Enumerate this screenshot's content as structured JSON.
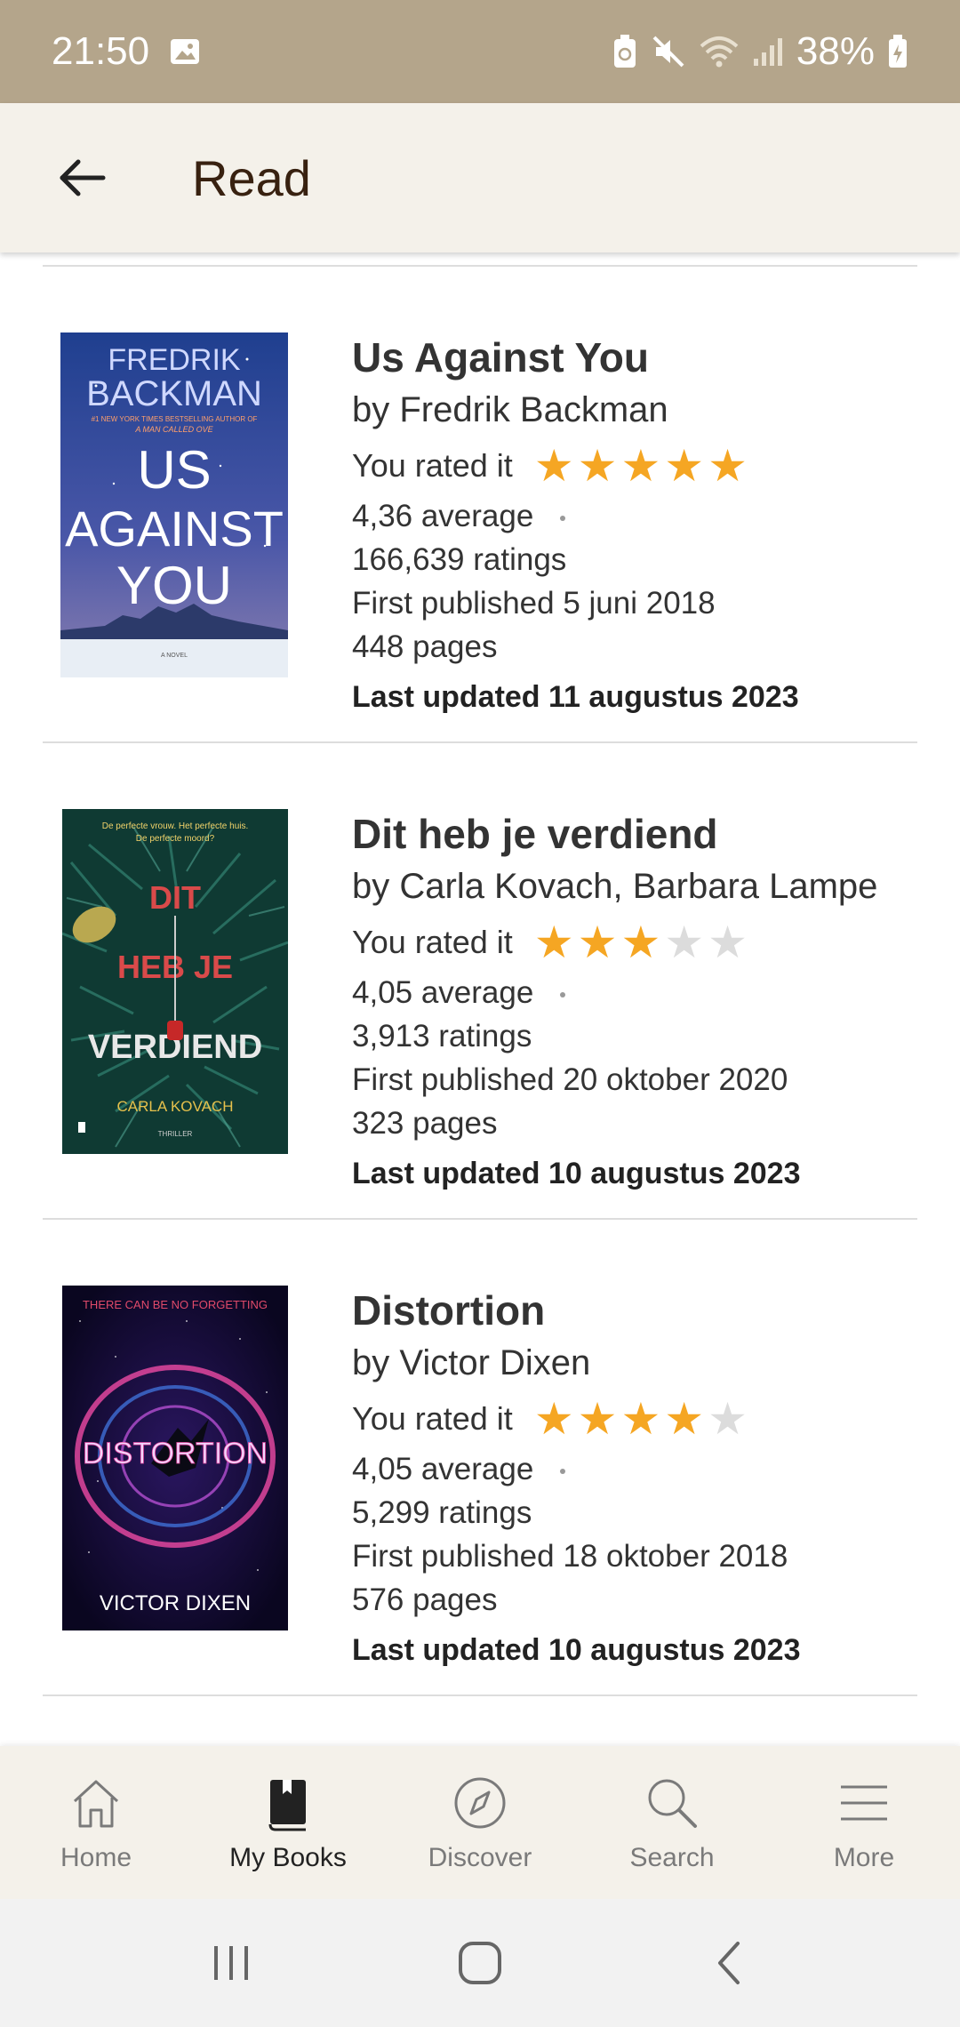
{
  "status_bar": {
    "time": "21:50",
    "battery": "38%"
  },
  "app_bar": {
    "title": "Read",
    "back_icon": "arrow-left-icon"
  },
  "books": [
    {
      "title": "Us Against You",
      "author": "by Fredrik Backman",
      "rated_label": "You rated it",
      "rating": 5,
      "average": "4,36 average",
      "ratings": "166,639 ratings",
      "published": "First published 5 juni 2018",
      "pages": "448 pages",
      "updated": "Last updated 11 augustus 2023",
      "cover": {
        "author_line1": "FREDRIK",
        "author_line2": "BACKMAN",
        "tagline_1": "#1 NEW YORK TIMES BESTSELLING AUTHOR OF",
        "tagline_2": "A MAN CALLED OVE",
        "title_1": "US",
        "title_2": "AGAINST",
        "title_3": "YOU",
        "footer": "A NOVEL",
        "bg_top": "#1f3f8f",
        "bg_bottom": "#6a5a9c"
      }
    },
    {
      "title": "Dit heb je verdiend",
      "author": "by Carla Kovach, Barbara Lampe",
      "rated_label": "You rated it",
      "rating": 3,
      "average": "4,05 average",
      "ratings": "3,913 ratings",
      "published": "First published 20 oktober 2020",
      "pages": "323 pages",
      "updated": "Last updated 10 augustus 2023",
      "cover": {
        "tagline_1": "De perfecte vrouw. Het perfecte huis.",
        "tagline_2": "De perfecte moord?",
        "title_1": "DIT",
        "title_2": "HEB JE",
        "title_3": "VERDIEND",
        "author": "CARLA KOVACH",
        "genre": "THRILLER",
        "bg": "#0f3a33"
      }
    },
    {
      "title": "Distortion",
      "author": "by Victor Dixen",
      "rated_label": "You rated it",
      "rating": 4,
      "average": "4,05 average",
      "ratings": "5,299 ratings",
      "published": "First published 18 oktober 2018",
      "pages": "576 pages",
      "updated": "Last updated 10 augustus 2023",
      "cover": {
        "tagline": "THERE CAN BE NO FORGETTING",
        "title": "DISTORTION",
        "author": "VICTOR DIXEN",
        "bg": "#120a2a"
      }
    }
  ],
  "bottom_nav": [
    {
      "label": "Home",
      "icon": "home-icon",
      "active": false
    },
    {
      "label": "My Books",
      "icon": "book-icon",
      "active": true
    },
    {
      "label": "Discover",
      "icon": "compass-icon",
      "active": false
    },
    {
      "label": "Search",
      "icon": "search-icon",
      "active": false
    },
    {
      "label": "More",
      "icon": "menu-icon",
      "active": false
    }
  ],
  "colors": {
    "status_bar": "#b4a58b",
    "app_bar": "#f4f1ea",
    "star_on": "#f5a623",
    "star_off": "#dcdcdc"
  }
}
